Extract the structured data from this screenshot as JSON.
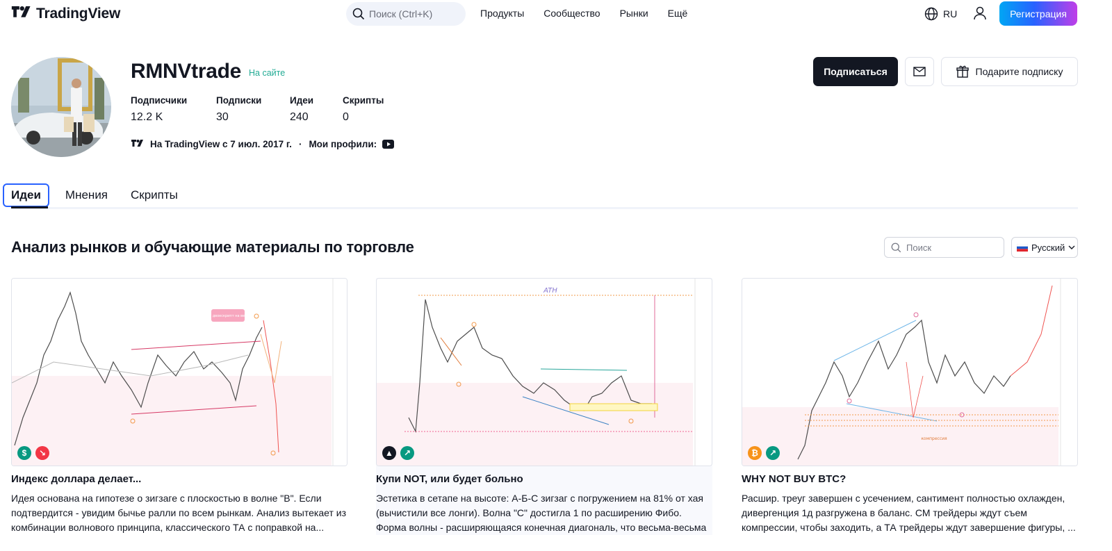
{
  "header": {
    "logo_text": "TradingView",
    "search_placeholder": "Поиск (Ctrl+K)",
    "nav": [
      "Продукты",
      "Сообщество",
      "Рынки",
      "Ещё"
    ],
    "lang": "RU",
    "register_label": "Регистрация"
  },
  "profile": {
    "username": "RMNVtrade",
    "status": "На сайте",
    "stats": [
      {
        "label": "Подписчики",
        "value": "12.2 K"
      },
      {
        "label": "Подписки",
        "value": "30"
      },
      {
        "label": "Идеи",
        "value": "240"
      },
      {
        "label": "Скрипты",
        "value": "0"
      }
    ],
    "since": "На TradingView с 7 июл. 2017 г.",
    "profiles_label": "Мои профили:",
    "subscribe_label": "Подписаться",
    "gift_label": "Подарите подписку"
  },
  "tabs": [
    "Идеи",
    "Мнения",
    "Скрипты"
  ],
  "section": {
    "title": "Анализ рынков и обучающие материалы по торговле",
    "search_placeholder": "Поиск",
    "language": "Русский"
  },
  "cards": [
    {
      "title": "Индекс доллара делает...",
      "description": "Идея основана на гипотезе о зигзаге с плоскостью в волне \"B\". Если подтвердится - увидим бычье ралли по всем рынкам. Анализ вытекает из комбинации волнового принципа, классического ТА с поправкой на...",
      "annotation": "Клин с двоескрипт на вершине"
    },
    {
      "title": "Купи NOT, или будет больно",
      "description": "Эстетика в сетапе на высоте: А-Б-С зигзаг с погружением на 81% от хая (вычистили все лонги). Волна \"С\" достигла 1 по расширению Фибо. Форма волны - расширяющаяся конечная диагональ, что весьма-весьма в стиле...",
      "annotation": "ATH"
    },
    {
      "title": "WHY NOT BUY BTC?",
      "description": "Расшир. треуг завершен с усечением, сантимент полностью охлажден, дивергенция 1д разгружена в баланс. СМ трейдеры ждут съем компрессии, чтобы заходить, а ТА трейдеры ждут завершение фигуры, ...",
      "annotation": "компрессия"
    }
  ]
}
